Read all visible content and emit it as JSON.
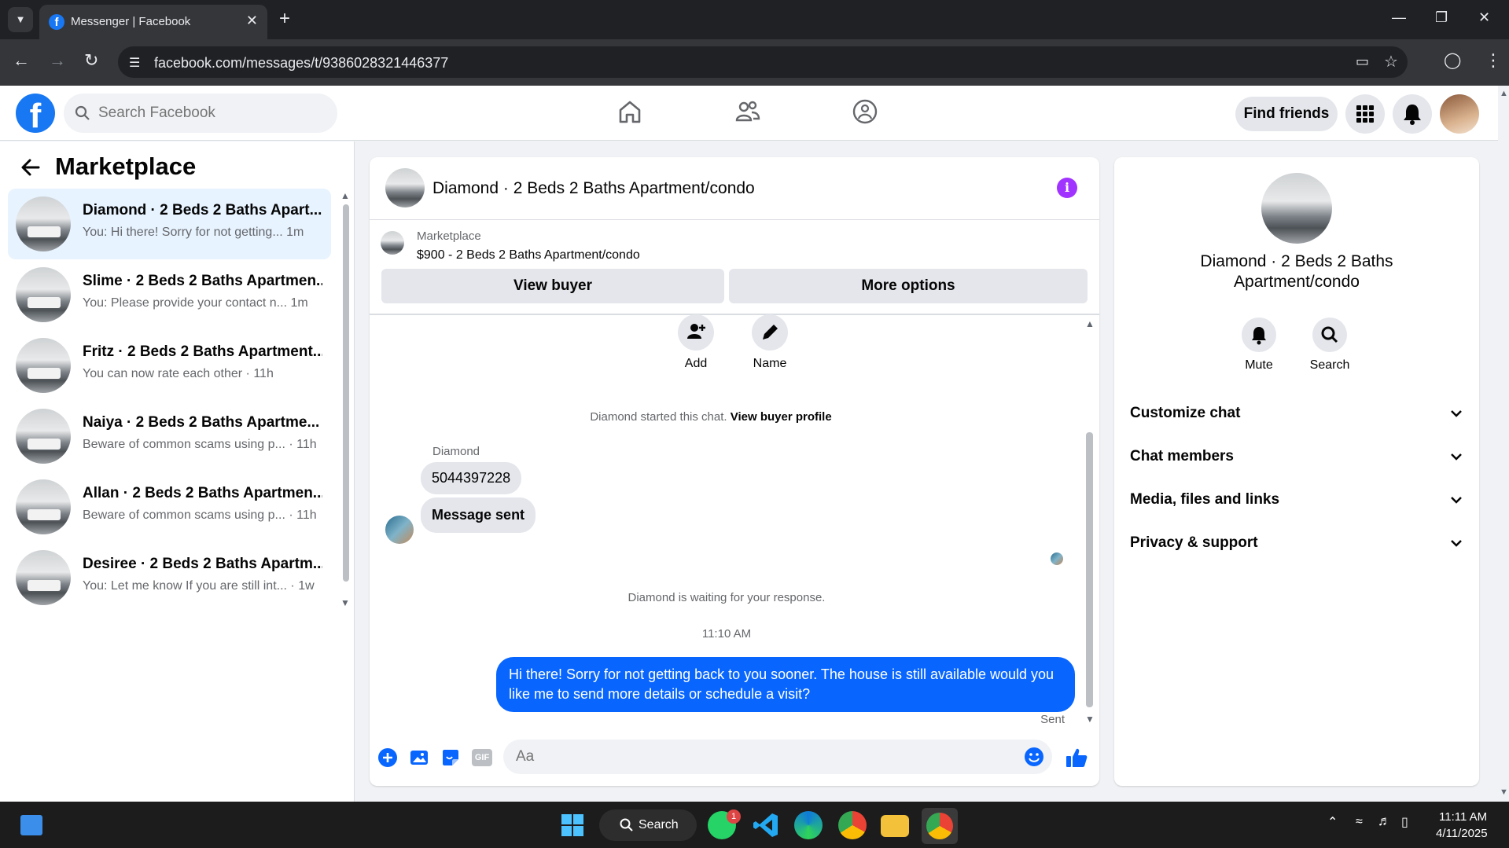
{
  "browser": {
    "tab_title": "Messenger | Facebook",
    "url": "facebook.com/messages/t/9386028321446377"
  },
  "header": {
    "search_placeholder": "Search Facebook",
    "find_friends": "Find friends"
  },
  "sidebar": {
    "title": "Marketplace",
    "conversations": [
      {
        "name": "Diamond · 2 Beds 2 Baths Apart...",
        "preview": "You: Hi there! Sorry for not getting...",
        "time": "1m",
        "active": true
      },
      {
        "name": "Slime · 2 Beds 2 Baths Apartmen...",
        "preview": "You: Please provide your contact n...",
        "time": "1m"
      },
      {
        "name": "Fritz · 2 Beds 2 Baths Apartment...",
        "preview": "You can now rate each other",
        "time": "11h"
      },
      {
        "name": "Naiya · 2 Beds 2 Baths Apartme...",
        "preview": "Beware of common scams using p...",
        "time": "11h"
      },
      {
        "name": "Allan · 2 Beds 2 Baths Apartmen...",
        "preview": "Beware of common scams using p...",
        "time": "11h"
      },
      {
        "name": "Desiree · 2 Beds 2 Baths Apartm...",
        "preview": "You: Let me know If you are still int...",
        "time": "1w"
      }
    ]
  },
  "chat": {
    "title": "Diamond · 2 Beds 2 Baths Apartment/condo",
    "marketplace_label": "Marketplace",
    "listing": "$900 - 2 Beds 2 Baths Apartment/condo",
    "view_buyer": "View buyer",
    "more_options": "More options",
    "add_label": "Add",
    "name_label": "Name",
    "started_text": "Diamond started this chat.",
    "view_buyer_profile": "View buyer profile",
    "sender": "Diamond",
    "msg1": "5044397228",
    "msg2": "Message sent",
    "waiting": "Diamond is waiting for your response.",
    "timestamp": "11:10 AM",
    "outgoing": "Hi there! Sorry for not getting back to you sooner. The house is still available would you like me to send more details or schedule a visit?",
    "sent_status": "Sent",
    "composer_placeholder": "Aa",
    "gif_label": "GIF"
  },
  "details": {
    "name": "Diamond · 2 Beds 2 Baths Apartment/condo",
    "mute": "Mute",
    "search": "Search",
    "sections": [
      "Customize chat",
      "Chat members",
      "Media, files and links",
      "Privacy & support"
    ]
  },
  "taskbar": {
    "search": "Search",
    "whatsapp_badge": "1",
    "time": "11:11 AM",
    "date": "4/11/2025"
  },
  "colors": {
    "brand": "#1877f2",
    "outgoing_bubble": "#0866ff",
    "info": "#a033ff"
  }
}
